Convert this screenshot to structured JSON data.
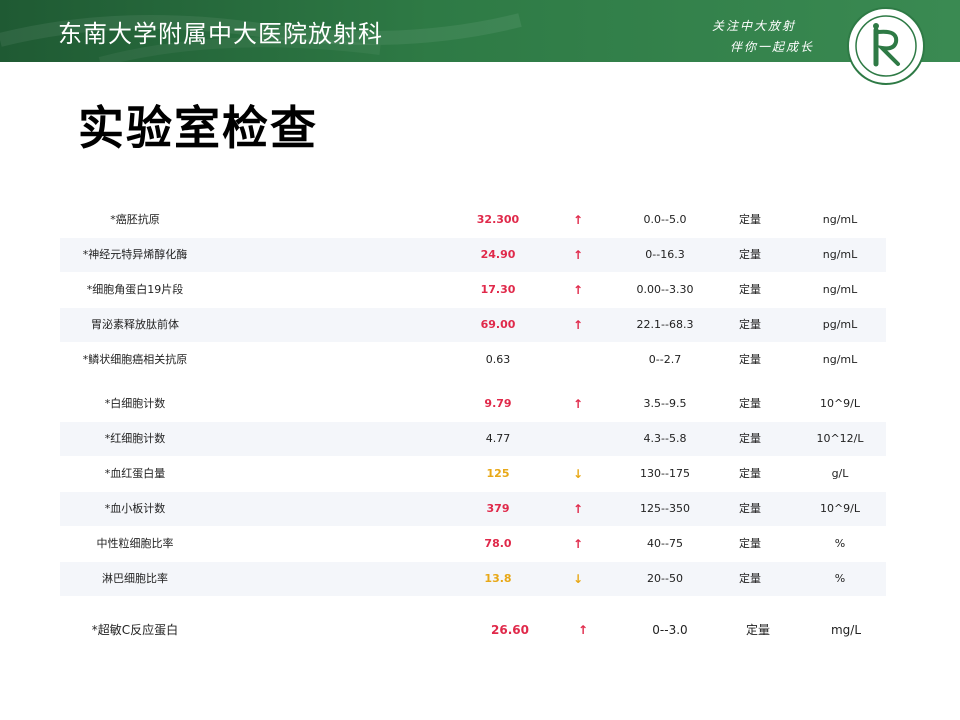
{
  "header": {
    "title": "东南大学附属中大医院放射科",
    "slogan_line1": "关注中大放射",
    "slogan_line2": "伴你一起成长",
    "logo_icon": "hospital-radiology-logo-icon"
  },
  "page_title": "实验室检查",
  "colors": {
    "high": "#e0294a",
    "low": "#e8a817",
    "banner": "#2e7a45"
  },
  "labs": [
    {
      "name": "*癌胚抗原",
      "value": "32.300",
      "arrow": "↑",
      "flag": "high",
      "range": "0.0--5.0",
      "type": "定量",
      "unit": "ng/mL"
    },
    {
      "name": "*神经元特异烯醇化酶",
      "value": "24.90",
      "arrow": "↑",
      "flag": "high",
      "range": "0--16.3",
      "type": "定量",
      "unit": "ng/mL"
    },
    {
      "name": "*细胞角蛋白19片段",
      "value": "17.30",
      "arrow": "↑",
      "flag": "high",
      "range": "0.00--3.30",
      "type": "定量",
      "unit": "ng/mL"
    },
    {
      "name": "胃泌素释放肽前体",
      "value": "69.00",
      "arrow": "↑",
      "flag": "high",
      "range": "22.1--68.3",
      "type": "定量",
      "unit": "pg/mL"
    },
    {
      "name": "*鳞状细胞癌相关抗原",
      "value": "0.63",
      "arrow": "",
      "flag": "normal",
      "range": "0--2.7",
      "type": "定量",
      "unit": "ng/mL"
    },
    {
      "name": "*白细胞计数",
      "value": "9.79",
      "arrow": "↑",
      "flag": "high",
      "range": "3.5--9.5",
      "type": "定量",
      "unit": "10^9/L"
    },
    {
      "name": "*红细胞计数",
      "value": "4.77",
      "arrow": "",
      "flag": "normal",
      "range": "4.3--5.8",
      "type": "定量",
      "unit": "10^12/L"
    },
    {
      "name": "*血红蛋白量",
      "value": "125",
      "arrow": "↓",
      "flag": "low",
      "range": "130--175",
      "type": "定量",
      "unit": "g/L"
    },
    {
      "name": "*血小板计数",
      "value": "379",
      "arrow": "↑",
      "flag": "high",
      "range": "125--350",
      "type": "定量",
      "unit": "10^9/L"
    },
    {
      "name": "中性粒细胞比率",
      "value": "78.0",
      "arrow": "↑",
      "flag": "high",
      "range": "40--75",
      "type": "定量",
      "unit": "%"
    },
    {
      "name": "淋巴细胞比率",
      "value": "13.8",
      "arrow": "↓",
      "flag": "low",
      "range": "20--50",
      "type": "定量",
      "unit": "%"
    },
    {
      "name": "*超敏C反应蛋白",
      "value": "26.60",
      "arrow": "↑",
      "flag": "high",
      "range": "0--3.0",
      "type": "定量",
      "unit": "mg/L"
    }
  ]
}
